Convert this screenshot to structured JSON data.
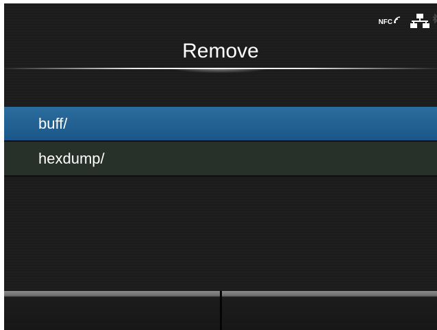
{
  "screen": {
    "title": "Remove",
    "status_icons": {
      "nfc_label": "NFC",
      "nfc": "nfc-icon",
      "network": "network-icon",
      "bluetooth": "bluetooth-icon"
    }
  },
  "list": {
    "items": [
      {
        "label": "buff/",
        "selected": true
      },
      {
        "label": "hexdump/",
        "selected": false
      }
    ]
  },
  "colors": {
    "selected_item": "#1f5f90",
    "unselected_item": "#28302a",
    "background": "#1c1c1c",
    "text": "#ffffff"
  }
}
